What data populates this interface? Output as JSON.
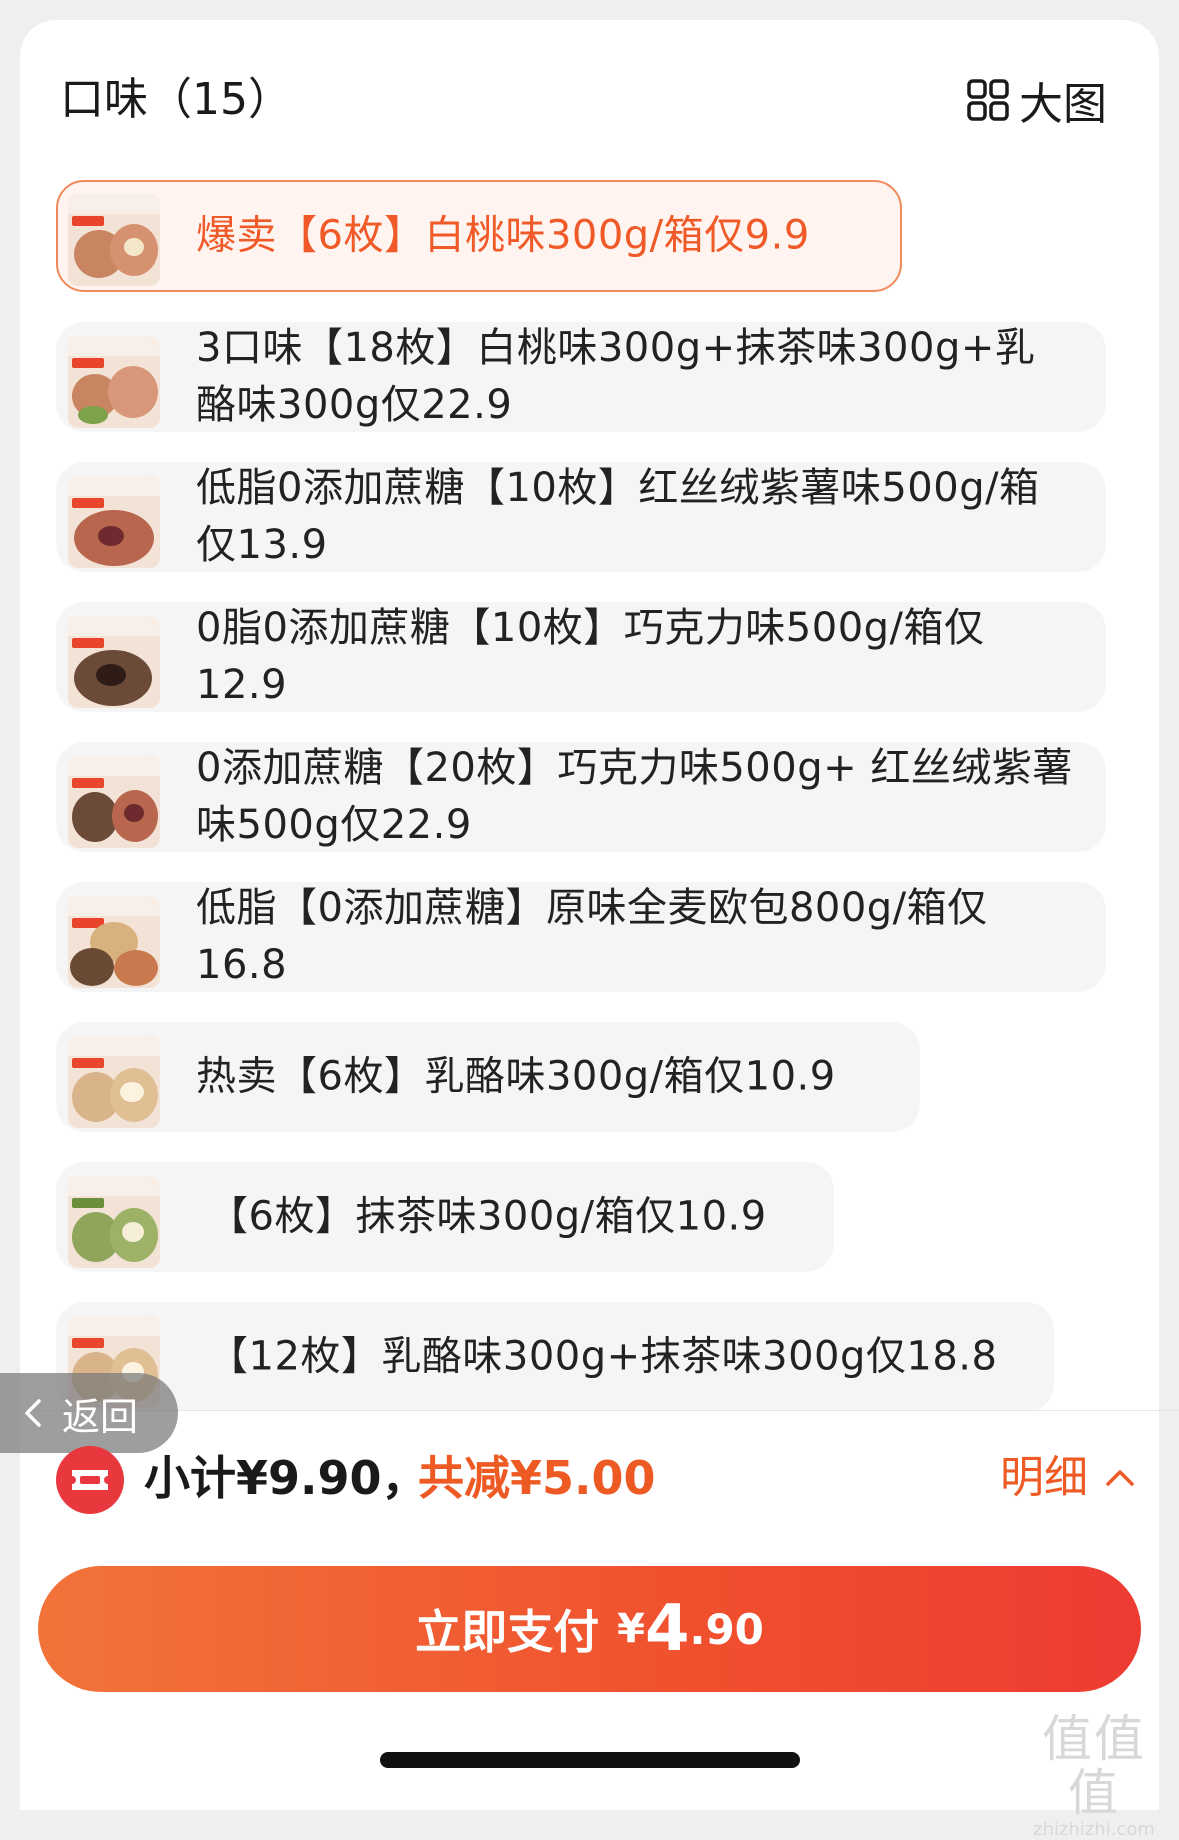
{
  "header": {
    "title": "口味（15）",
    "view_toggle_label": "大图"
  },
  "options": [
    {
      "label": "爆卖【6枚】白桃味300g/箱仅9.9",
      "selected": true
    },
    {
      "label": "3口味【18枚】白桃味300g+抹茶味300g+乳酪味300g仅22.9",
      "selected": false
    },
    {
      "label": "低脂0添加蔗糖【10枚】红丝绒紫薯味500g/箱仅13.9",
      "selected": false
    },
    {
      "label": "0脂0添加蔗糖【10枚】巧克力味500g/箱仅12.9",
      "selected": false
    },
    {
      "label": "0添加蔗糖【20枚】巧克力味500g+ 红丝绒紫薯味500g仅22.9",
      "selected": false
    },
    {
      "label": "低脂【0添加蔗糖】原味全麦欧包800g/箱仅16.8",
      "selected": false
    },
    {
      "label": "热卖【6枚】乳酪味300g/箱仅10.9",
      "selected": false
    },
    {
      "label": "【6枚】抹茶味300g/箱仅10.9",
      "selected": false
    },
    {
      "label": "【12枚】乳酪味300g+抹茶味300g仅18.8",
      "selected": false
    }
  ],
  "back_label": "返回",
  "summary": {
    "subtotal": "小计¥9.90，",
    "discount": "共减¥5.00",
    "detail_label": "明细"
  },
  "pay": {
    "label": "立即支付",
    "currency": "¥",
    "amount_int": "4",
    "amount_dec": ".90"
  },
  "watermark": {
    "main": "值值值",
    "sub": "zhizhizhi.com"
  },
  "colors": {
    "accent": "#ee5a24",
    "selected_border": "#f08a5d",
    "selected_bg": "#fff4ef",
    "option_bg": "#f5f5f5",
    "pay_gradient_start": "#f2733a",
    "pay_gradient_end": "#ee3b32"
  },
  "icons": [
    "grid-view-icon",
    "chevron-left-icon",
    "chevron-up-icon",
    "coupon-icon"
  ]
}
